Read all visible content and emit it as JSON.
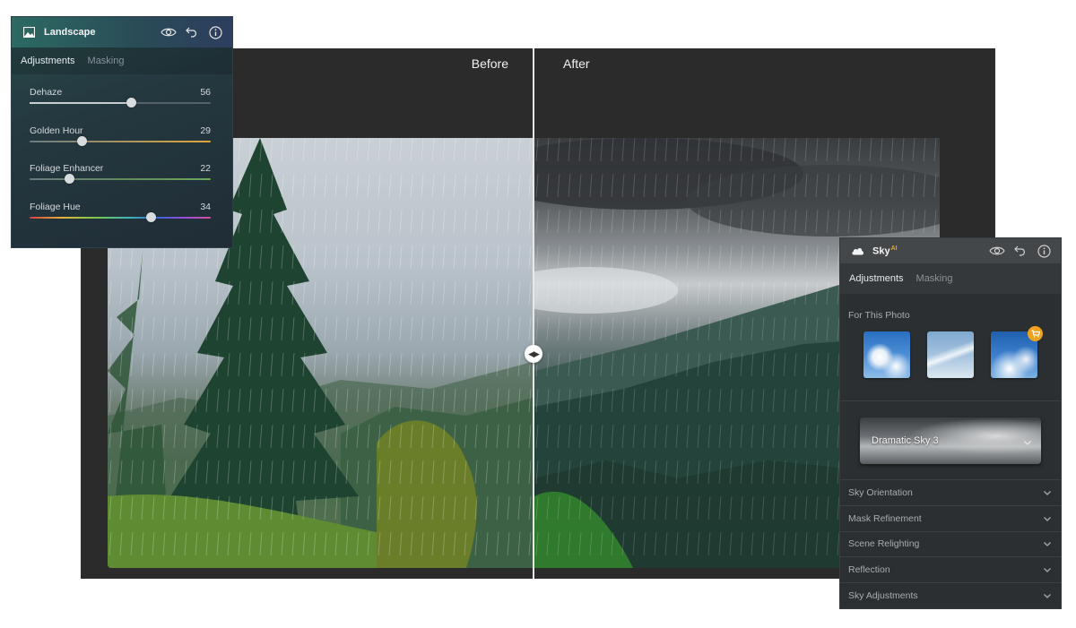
{
  "editor": {
    "before_label": "Before",
    "after_label": "After"
  },
  "landscape_panel": {
    "title": "Landscape",
    "icon": "image-icon",
    "tabs": [
      {
        "label": "Adjustments",
        "active": true
      },
      {
        "label": "Masking",
        "active": false
      }
    ],
    "sliders": [
      {
        "label": "Dehaze",
        "value": "56",
        "position": 0.56
      },
      {
        "label": "Golden Hour",
        "value": "29",
        "position": 0.29
      },
      {
        "label": "Foliage Enhancer",
        "value": "22",
        "position": 0.22
      },
      {
        "label": "Foliage Hue",
        "value": "34",
        "position": 0.67
      }
    ]
  },
  "sky_panel": {
    "title": "Sky",
    "title_badge": "AI",
    "icon": "cloud-icon",
    "tabs": [
      {
        "label": "Adjustments",
        "active": true
      },
      {
        "label": "Masking",
        "active": false
      }
    ],
    "section_label": "For This Photo",
    "preset_selected": "Dramatic Sky 3",
    "accordion": [
      {
        "label": "Sky Orientation"
      },
      {
        "label": "Mask Refinement"
      },
      {
        "label": "Scene Relighting"
      },
      {
        "label": "Reflection"
      },
      {
        "label": "Sky Adjustments"
      }
    ]
  },
  "colors": {
    "accent_badge": "#f0a21e",
    "panel_bg": "#2b2f31"
  }
}
